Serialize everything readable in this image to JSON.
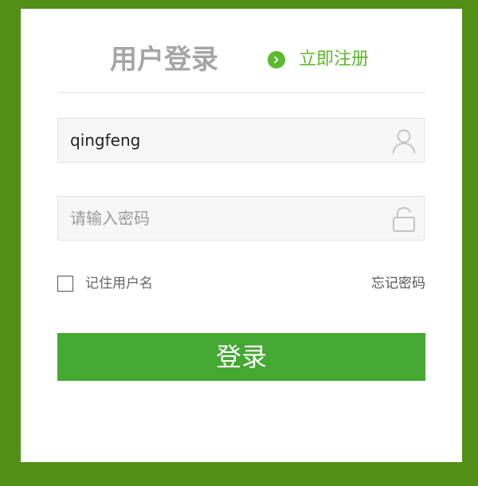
{
  "colors": {
    "page_background": "#528f16",
    "accent_green": "#5cb82e",
    "button_green": "#44a832",
    "title_gray": "#a5a5a5"
  },
  "header": {
    "title": "用户登录",
    "register_icon": "chevron-right-circle-icon",
    "register_label": "立即注册"
  },
  "form": {
    "username": {
      "value": "qingfeng",
      "placeholder": "",
      "icon": "user-icon"
    },
    "password": {
      "value": "",
      "placeholder": "请输入密码",
      "icon": "unlock-icon"
    },
    "remember": {
      "label": "记住用户名",
      "checked": false
    },
    "forgot_label": "忘记密码",
    "submit_label": "登录"
  }
}
